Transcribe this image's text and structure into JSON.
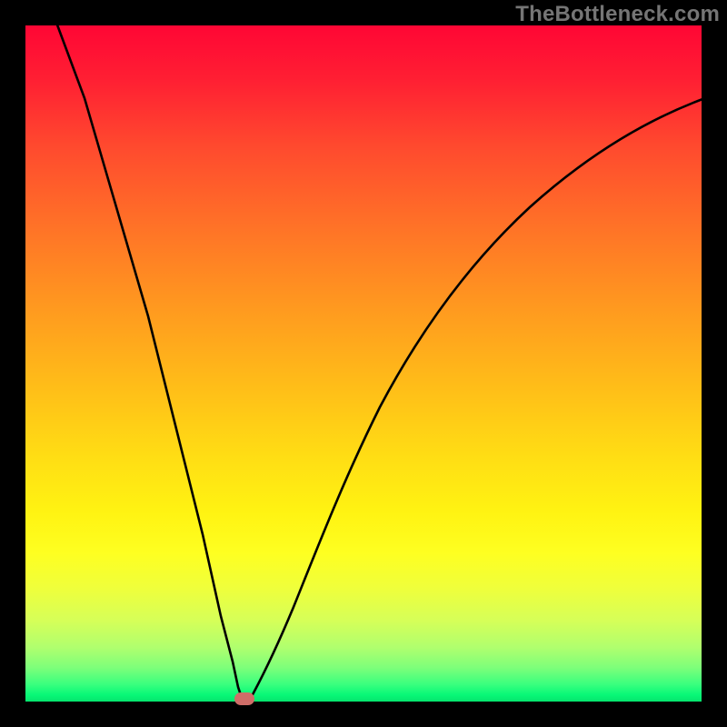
{
  "watermark": "TheBottleneck.com",
  "colors": {
    "frame": "#000000",
    "curve": "#000000",
    "marker": "#cf6d68",
    "gradient_top": "#ff0634",
    "gradient_mid": "#fff312",
    "gradient_bottom": "#06e46d"
  },
  "chart_data": {
    "type": "line",
    "title": "",
    "xlabel": "",
    "ylabel": "",
    "xlim": [
      0,
      100
    ],
    "ylim": [
      0,
      100
    ],
    "grid": false,
    "legend": false,
    "annotations": [
      "TheBottleneck.com"
    ],
    "series": [
      {
        "name": "left-branch",
        "x": [
          5,
          8,
          12,
          16,
          20,
          24,
          27,
          29,
          30.5,
          31.5
        ],
        "y": [
          100,
          88,
          72,
          56,
          40,
          24,
          12,
          5,
          1.5,
          0.5
        ]
      },
      {
        "name": "right-branch",
        "x": [
          33,
          35,
          38,
          42,
          47,
          53,
          60,
          68,
          77,
          87,
          100
        ],
        "y": [
          0.5,
          3,
          8,
          16,
          26,
          37,
          48,
          58,
          67,
          75,
          82
        ]
      }
    ],
    "marker": {
      "x": 32,
      "y": 0.3
    }
  },
  "layout": {
    "plot_left": 28,
    "plot_top": 28,
    "plot_size": 744
  }
}
